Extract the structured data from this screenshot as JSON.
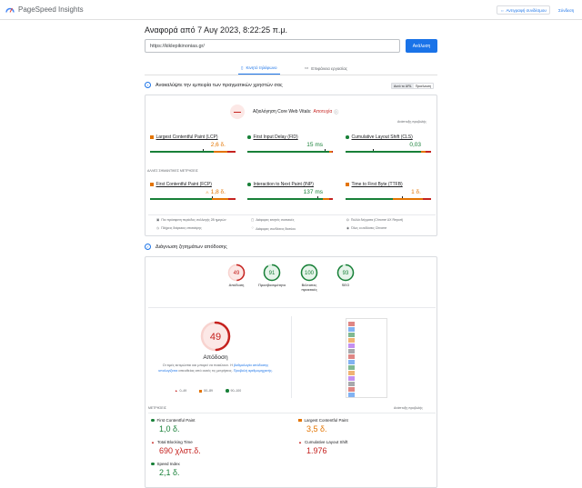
{
  "header": {
    "brand": "PageSpeed Insights",
    "copy_link_label": "Αντιγραφή συνδέσμου",
    "sign_in_label": "Σύνδεση"
  },
  "report": {
    "title": "Αναφορά από 7 Αυγ 2023, 8:22:25 π.μ.",
    "url": "https://kiklepikinonias.gr/",
    "analyze_label": "Ανάλυση"
  },
  "tabs": [
    {
      "label": "Κινητό τηλέφωνο",
      "icon": "phone-icon"
    },
    {
      "label": "Επιφάνεια εργασίας",
      "icon": "desktop-icon"
    }
  ],
  "field": {
    "heading": "Ανακαλύψτε την εμπειρία των πραγματικών χρηστών σας",
    "toggle": [
      "Αυτό το URL",
      "Προέλευση"
    ],
    "cwv_label": "Αξιολόγηση Core Web Vitals:",
    "cwv_status": "Αποτυχία",
    "expand_label": "Ανάπτυξη προβολής",
    "other_metrics_label": "ΑΛΛΕΣ ΣΗΜΑΝΤΙΚΕΣ ΜΕΤΡΗΣΕΙΣ",
    "core_metrics": [
      {
        "name": "Largest Contentful Paint (LCP)",
        "value": "2,6 δ.",
        "status": "average",
        "dist": [
          74,
          16,
          10
        ],
        "marker": 0.62
      },
      {
        "name": "First Input Delay (FID)",
        "value": "15 ms",
        "status": "good",
        "dist": [
          96,
          3,
          1
        ],
        "marker": 0.9
      },
      {
        "name": "Cumulative Layout Shift (CLS)",
        "value": "0,03",
        "status": "good",
        "dist": [
          88,
          6,
          6
        ],
        "marker": 0.32
      }
    ],
    "other_metrics": [
      {
        "name": "First Contentful Paint (FCP)",
        "value": "1,8 δ.",
        "prefix": "⚠",
        "status": "average",
        "dist": [
          72,
          20,
          8
        ],
        "marker": 0.72
      },
      {
        "name": "Interaction to Next Paint (INP)",
        "value": "137 ms",
        "status": "good",
        "dist": [
          88,
          8,
          4
        ],
        "marker": 0.82
      },
      {
        "name": "Time to First Byte (TTFB)",
        "value": "1 δ.",
        "status": "average",
        "dist": [
          55,
          35,
          10
        ],
        "marker": 0.66
      }
    ],
    "info": [
      "Πιο πρόσφατη περίοδος συλλογής 28 ημερών",
      "Διάφορες κινητές συσκευές",
      "Πολλά δείγματα (Chrome UX Report)",
      "Πλήρεις διάρκειες επισκέψης",
      "Διάφορες συνδέσεις δικτύου",
      "Όλες οι εκδόσεις Chrome"
    ]
  },
  "diagnostics": {
    "heading": "Διάγνωση ζητημάτων απόδοσης",
    "scores": [
      {
        "value": 49,
        "label": "Απόδοση",
        "color": "#c5221f"
      },
      {
        "value": 91,
        "label": "Προσβασιμότητα",
        "color": "#188038"
      },
      {
        "value": 100,
        "label": "Βέλτιστες πρακτικές",
        "color": "#188038"
      },
      {
        "value": 93,
        "label": "SEO",
        "color": "#188038"
      }
    ],
    "big_score": 49,
    "big_label": "Απόδοση",
    "note_prefix": "Οι τιμές εκτιμώνται και μπορεί να ποικίλουν. Η",
    "note_link": "βαθμολογία απόδοσης υπολογίζεται",
    "note_suffix": "απευθείας από αυτές τις μετρήσεις.",
    "note_link2": "Προβολή αριθμομηχανής.",
    "legend": [
      "0–49",
      "50–89",
      "90–100"
    ],
    "metrics_label": "ΜΕΤΡΗΣΕΙΣ",
    "expand_label": "Ανάπτυξη προβολής",
    "lab_metrics": [
      {
        "name": "First Contentful Paint",
        "value": "1,0 δ.",
        "status": "good"
      },
      {
        "name": "Largest Contentful Paint",
        "value": "3,5 δ.",
        "status": "average"
      },
      {
        "name": "Total Blocking Time",
        "value": "690 χλστ.δ.",
        "status": "bad"
      },
      {
        "name": "Cumulative Layout Shift",
        "value": "1.976",
        "status": "bad"
      },
      {
        "name": "Speed Index",
        "value": "2,1 δ.",
        "status": "good"
      }
    ]
  },
  "colors": {
    "accent": "#1a73e8",
    "good": "#188038",
    "average": "#e37400",
    "bad": "#c5221f"
  }
}
